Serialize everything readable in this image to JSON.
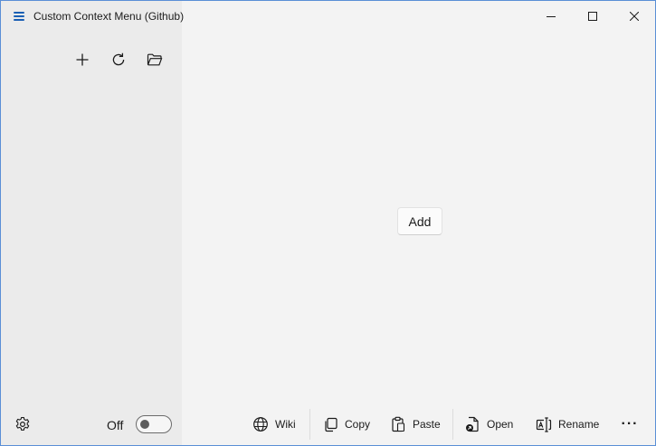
{
  "window": {
    "title": "Custom Context Menu (Github)",
    "accent_color": "#1a5fb4",
    "border_color": "#5a8fd6"
  },
  "caption_buttons": [
    {
      "name": "minimize",
      "icon": "minimize-icon"
    },
    {
      "name": "maximize",
      "icon": "maximize-icon"
    },
    {
      "name": "close",
      "icon": "close-icon"
    }
  ],
  "sidebar": {
    "tools": [
      {
        "name": "add",
        "icon": "plus-icon"
      },
      {
        "name": "refresh",
        "icon": "refresh-icon"
      },
      {
        "name": "open-folder",
        "icon": "folder-icon"
      }
    ],
    "settings_icon": "gear-icon",
    "toggle": {
      "label": "Off",
      "state": false
    }
  },
  "main": {
    "add_button_label": "Add"
  },
  "command_bar": {
    "wiki": {
      "label": "Wiki",
      "icon": "globe-icon"
    },
    "copy": {
      "label": "Copy",
      "icon": "copy-icon"
    },
    "paste": {
      "label": "Paste",
      "icon": "paste-icon"
    },
    "open": {
      "label": "Open",
      "icon": "open-file-icon"
    },
    "rename": {
      "label": "Rename",
      "icon": "rename-icon"
    },
    "more_label": "···"
  }
}
